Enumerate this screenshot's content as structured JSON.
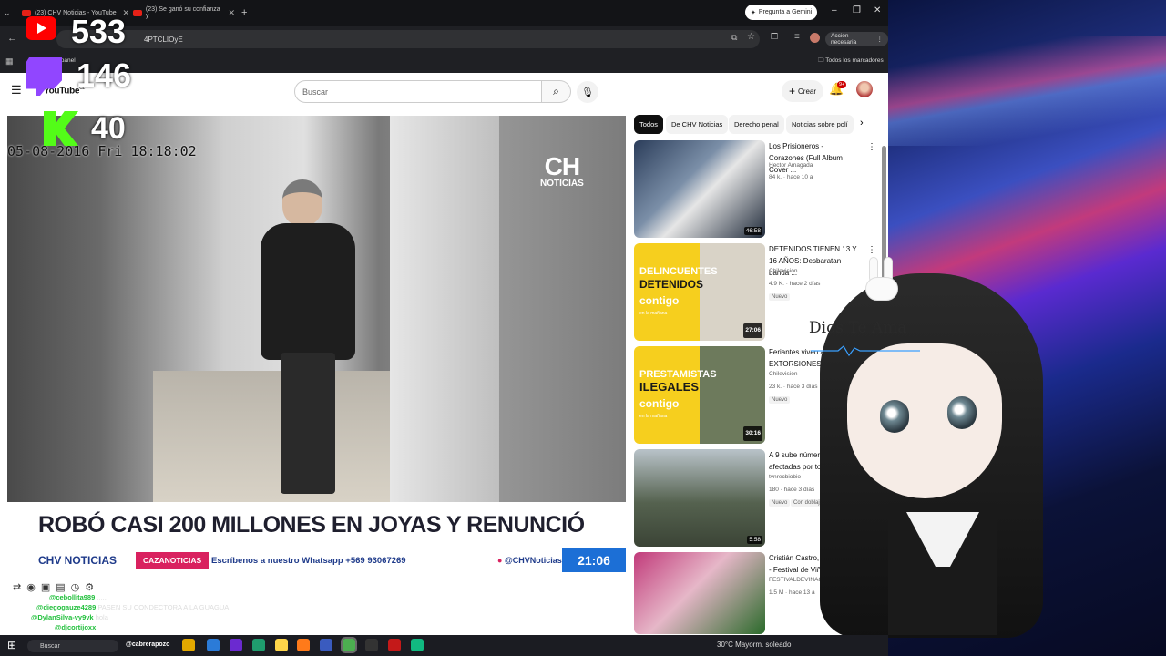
{
  "browser": {
    "tabs": [
      {
        "title": "(23) CHV Noticias - YouTube"
      },
      {
        "title": "(23) Se ganó su confianza y"
      }
    ],
    "gemini_label": "Pregunta a Gemini",
    "url": "4PTCLIOyE",
    "action_needed": "Acción necesaria",
    "all_bookmarks": "Todos los marcadores",
    "bookmark_item": "Volver al panel"
  },
  "youtube": {
    "logo_text": "YouTube",
    "logo_region": "CL",
    "search_placeholder": "Buscar",
    "create_label": "Crear",
    "notif_count": "9+",
    "chips": [
      "Todos",
      "De CHV Noticias",
      "Derecho penal",
      "Noticias sobre polí"
    ],
    "recommendations": [
      {
        "title": "Los Prisioneros - Corazones (Full Album Cover ...",
        "channel": "Hector Amagada",
        "meta": "84 k. · hace 10 a",
        "duration": "46:58",
        "badge": ""
      },
      {
        "title": "DETENIDOS TIENEN 13 Y 16 AÑOS: Desbaratan banda ...",
        "channel": "Chilevisión",
        "meta": "4.9 K. · hace 2 días",
        "duration": "27:06",
        "badge": "Nuevo",
        "promo": [
          "DELINCUENTES",
          "DETENIDOS"
        ]
      },
      {
        "title": "Feriantes viven a... por EXTORSIONES",
        "channel": "Chilevisión",
        "meta": "23 k. · hace 3 días",
        "duration": "30:16",
        "badge": "Nuevo",
        "promo": [
          "PRESTAMISTAS",
          "ILEGALES"
        ]
      },
      {
        "title": "A 9 sube número de ... afectadas por tornado",
        "channel": "tvnrecbiobio",
        "meta": "180 · hace 3 días",
        "duration": "5:58",
        "badge": "Nuevo",
        "dubbed": "Con doblaje automático"
      },
      {
        "title": "Cristián Castro, No Podrás - Festival de Viña 2002",
        "channel": "FESTIVALDEVINACHILE",
        "meta": "1.5 M · hace 13 a",
        "duration": "",
        "badge": ""
      }
    ],
    "promo_brand": "contigo",
    "promo_tagline": "en la mañana"
  },
  "video": {
    "timestamp": "05-08-2016 Fri 18:18:02",
    "channel_logo_top": "CH",
    "channel_logo_bottom": "NOTICIAS",
    "headline": "ROBÓ CASI 200 MILLONES EN JOYAS Y RENUNCIÓ",
    "strip_channel": "CHV NOTICIAS",
    "strip_tag": "CAZANOTICIAS",
    "strip_whatsapp": "Escríbenos a nuestro Whatsapp +569 93067269",
    "strip_facebook": "@CHVNoticias",
    "strip_time": "21:06"
  },
  "overlay": {
    "youtube_count": "533",
    "twitch_count": "146",
    "kick_count": "40",
    "dios_te_ama": "Dios Te Ama",
    "chat": [
      {
        "user": "@cebollita989",
        "msg": "....."
      },
      {
        "user": "@diegogauze4289",
        "msg": "PASEN SU CONDECTORA A LA GUAGUA"
      },
      {
        "user": "@DylanSilva-vy9vk",
        "msg": "hola"
      },
      {
        "user": "@djcortijoxx",
        "msg": "a lo pirata"
      }
    ],
    "chat_author_tag": "@cabrerapozo"
  },
  "taskbar": {
    "search": "Buscar",
    "weather": "30°C  Mayorm. soleado"
  },
  "colors": {
    "chv_blue": "#1c6fd6",
    "caza_pink": "#d9215f",
    "kick_green": "#53fc18",
    "twitch_purple": "#9146ff",
    "youtube_red": "#ff0000"
  }
}
